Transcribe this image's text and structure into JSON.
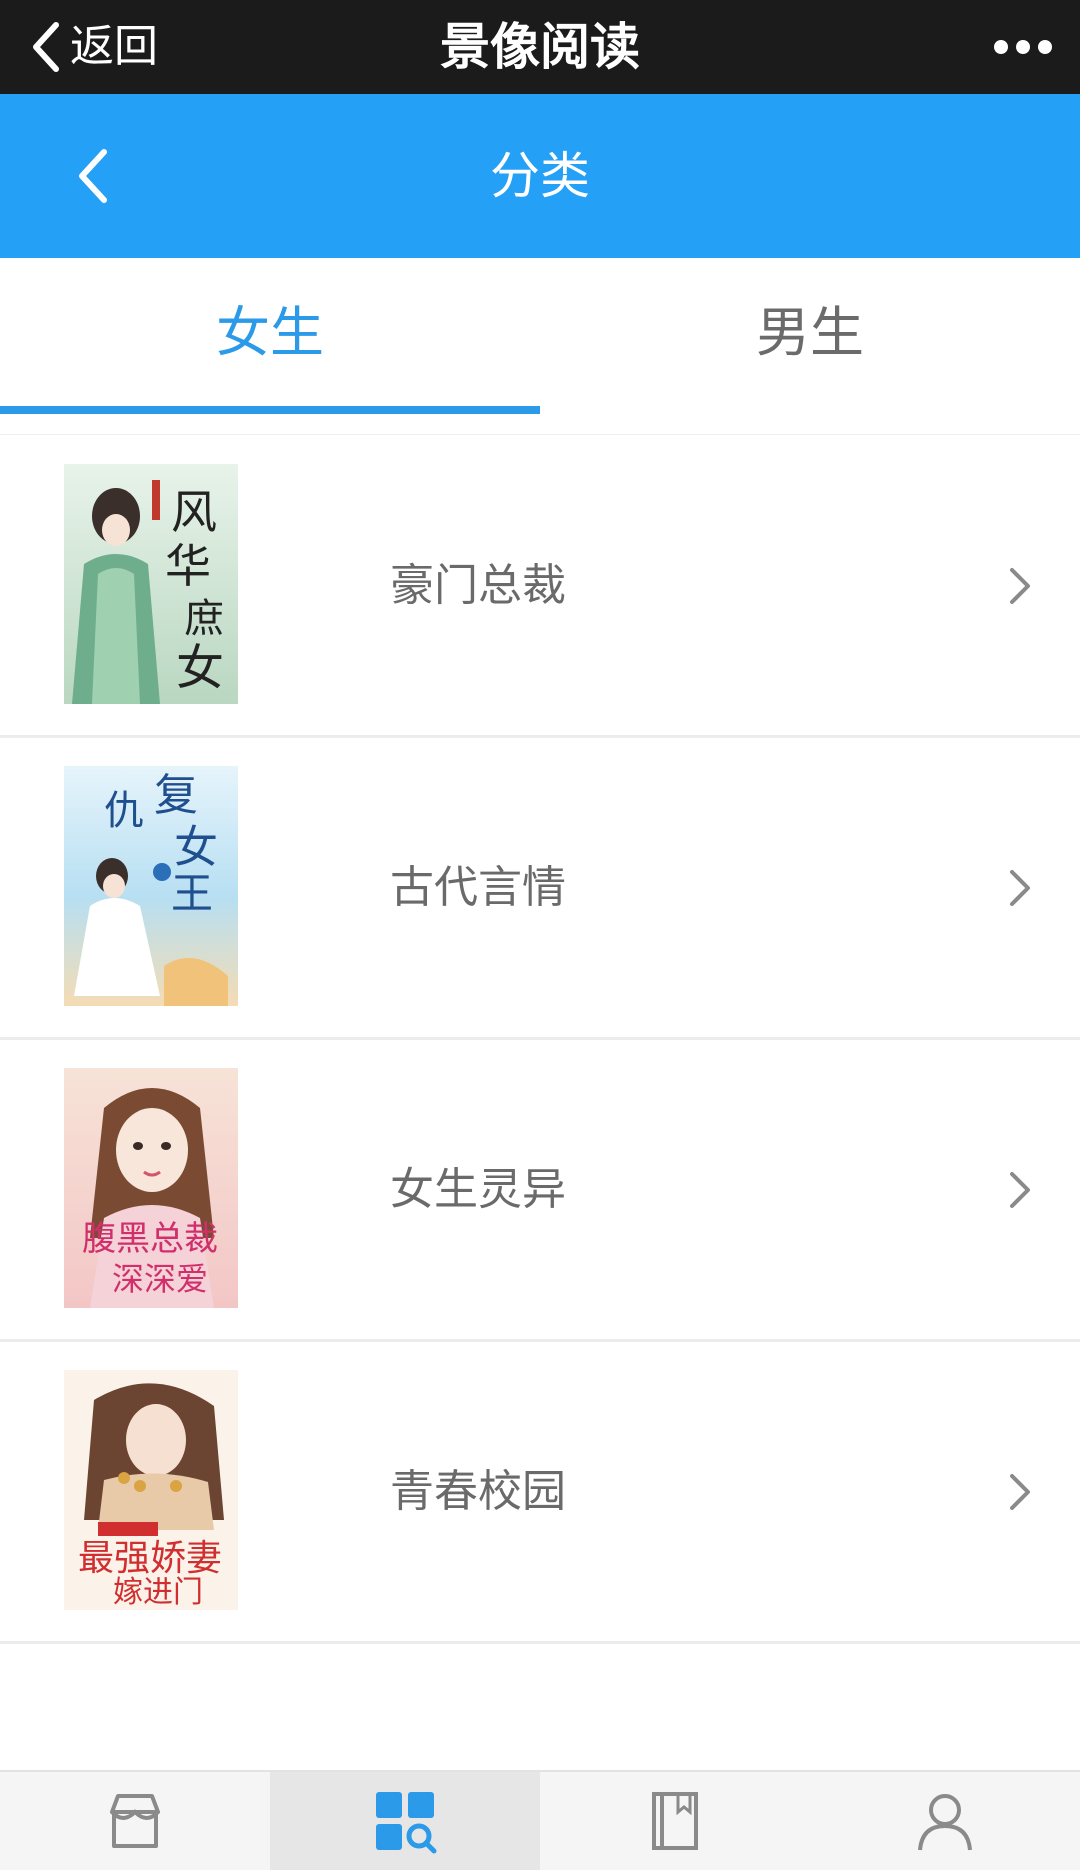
{
  "wechat_bar": {
    "back_label": "返回",
    "title": "景像阅读",
    "more_icon": "more-dots-icon"
  },
  "header": {
    "back_icon": "chevron-left-icon",
    "title": "分类"
  },
  "tabs": [
    {
      "label": "女生",
      "active": true
    },
    {
      "label": "男生",
      "active": false
    }
  ],
  "categories": [
    {
      "name": "豪门总裁",
      "cover_text": "风华庶女"
    },
    {
      "name": "古代言情",
      "cover_text": "复仇女王"
    },
    {
      "name": "女生灵异",
      "cover_text": "腹黑总裁深深爱"
    },
    {
      "name": "青春校园",
      "cover_text": "最强娇妻嫁进门"
    }
  ],
  "bottom_nav": [
    {
      "icon": "store-icon",
      "label": "",
      "active": false
    },
    {
      "icon": "category-search-icon",
      "label": "",
      "active": true
    },
    {
      "icon": "bookshelf-icon",
      "label": "",
      "active": false
    },
    {
      "icon": "user-icon",
      "label": "",
      "active": false
    }
  ],
  "colors": {
    "accent": "#25a0f7",
    "tab_active": "#2b9ae8",
    "wechat_bar": "#1b1b1b"
  }
}
